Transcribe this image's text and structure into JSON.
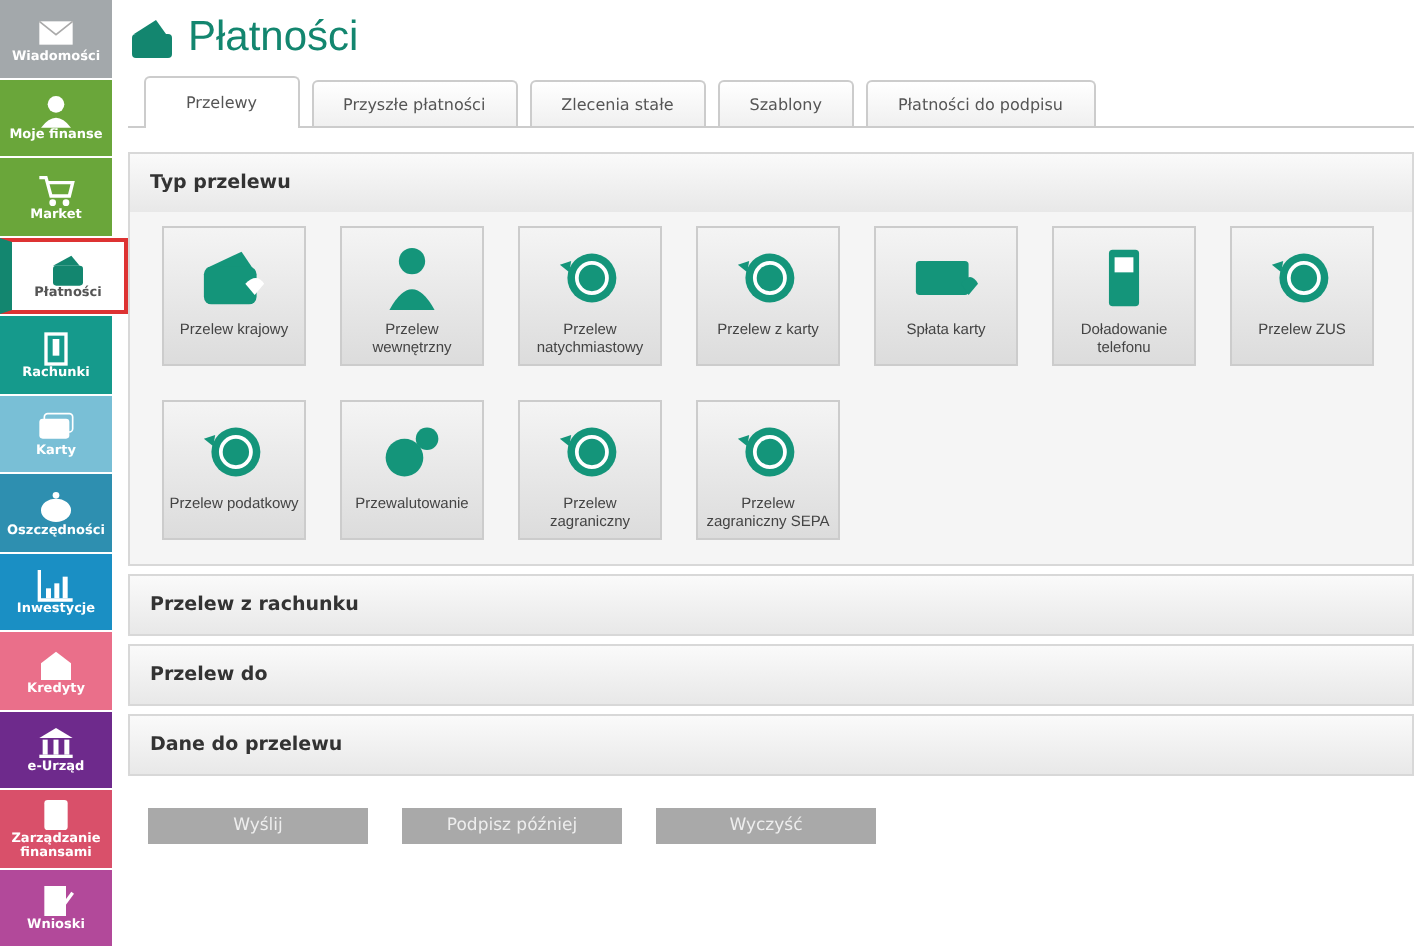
{
  "sidebar": {
    "items": [
      {
        "label": "Wiadomości",
        "color": "#a3a8ab",
        "selected": false
      },
      {
        "label": "Moje finanse",
        "color": "#6aa63a",
        "selected": false
      },
      {
        "label": "Market",
        "color": "#6aa63a",
        "selected": false
      },
      {
        "label": "Płatności",
        "color": "#13866f",
        "selected": true
      },
      {
        "label": "Rachunki",
        "color": "#159a8c",
        "selected": false
      },
      {
        "label": "Karty",
        "color": "#79bfd6",
        "selected": false
      },
      {
        "label": "Oszczędności",
        "color": "#2e8fb0",
        "selected": false
      },
      {
        "label": "Inwestycje",
        "color": "#1a8fc4",
        "selected": false
      },
      {
        "label": "Kredyty",
        "color": "#ea6f8a",
        "selected": false
      },
      {
        "label": "e-Urząd",
        "color": "#6e2a8c",
        "selected": false
      },
      {
        "label": "Zarządzanie finansami",
        "color": "#d9506a",
        "selected": false
      },
      {
        "label": "Wnioski",
        "color": "#b2499a",
        "selected": false
      }
    ]
  },
  "page_title": "Płatności",
  "tabs": [
    {
      "label": "Przelewy",
      "selected": true
    },
    {
      "label": "Przyszłe płatności",
      "selected": false
    },
    {
      "label": "Zlecenia stałe",
      "selected": false
    },
    {
      "label": "Szablony",
      "selected": false
    },
    {
      "label": "Płatności do podpisu",
      "selected": false
    }
  ],
  "sections": [
    {
      "title": "Typ przelewu",
      "tiles": [
        {
          "label": "Przelew krajowy"
        },
        {
          "label": "Przelew wewnętrzny"
        },
        {
          "label": "Przelew natychmiastowy"
        },
        {
          "label": "Przelew z karty"
        },
        {
          "label": "Spłata karty"
        },
        {
          "label": "Doładowanie telefonu"
        },
        {
          "label": "Przelew ZUS"
        },
        {
          "label": "Przelew podatkowy"
        },
        {
          "label": "Przewalutowanie"
        },
        {
          "label": "Przelew zagraniczny"
        },
        {
          "label": "Przelew zagraniczny SEPA"
        }
      ]
    },
    {
      "title": "Przelew z rachunku"
    },
    {
      "title": "Przelew do"
    },
    {
      "title": "Dane do przelewu"
    }
  ],
  "buttons": [
    {
      "label": "Wyślij",
      "disabled": true
    },
    {
      "label": "Podpisz później",
      "disabled": true
    },
    {
      "label": "Wyczyść",
      "disabled": true
    }
  ]
}
